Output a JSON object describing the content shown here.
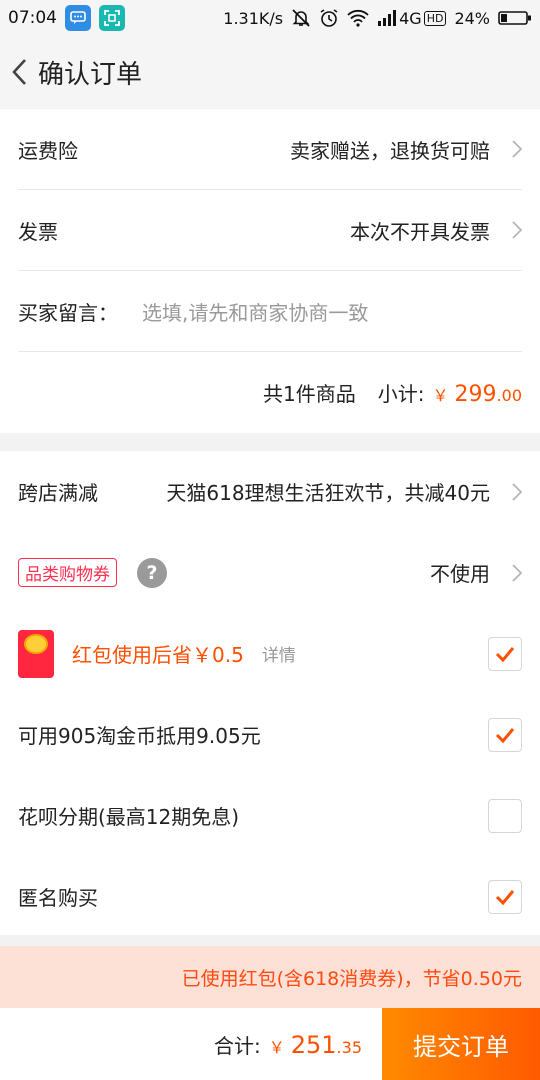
{
  "status_bar": {
    "time": "07:04",
    "speed": "1.31K/s",
    "network": "4G",
    "hd": "HD",
    "battery": "24%",
    "icons": [
      "chat-app-icon",
      "scan-app-icon",
      "mute-bell-icon",
      "alarm-icon",
      "wifi-icon",
      "signal-icon",
      "battery-icon"
    ]
  },
  "header": {
    "title": "确认订单"
  },
  "section1": {
    "shipping_insurance": {
      "label": "运费险",
      "value": "卖家赠送，退换货可赔"
    },
    "invoice": {
      "label": "发票",
      "value": "本次不开具发票"
    },
    "buyer_message": {
      "label": "买家留言：",
      "placeholder": "选填,请先和商家协商一致"
    },
    "subtotal": {
      "count": "共1件商品",
      "label": "小计:",
      "currency": "￥",
      "integer": "299",
      "decimal": ".00"
    }
  },
  "section2": {
    "cross_store": {
      "label": "跨店满减",
      "value": "天猫618理想生活狂欢节，共减40元"
    },
    "category_coupon": {
      "tag": "品类购物券",
      "help": "?",
      "value": "不使用"
    },
    "red_packet": {
      "text": "红包使用后省￥0.5",
      "detail": "详情",
      "checked": true
    },
    "taojinbi": {
      "text": "可用905淘金币抵用9.05元",
      "checked": true
    },
    "huabei": {
      "text": "花呗分期(最高12期免息)",
      "checked": false
    },
    "anonymous": {
      "text": "匿名购买",
      "checked": true
    }
  },
  "notice": {
    "text": "已使用红包(含618消费券)，节省0.50元"
  },
  "bottom_bar": {
    "total_label": "合计:",
    "currency": "￥",
    "integer": "251",
    "decimal": ".35",
    "submit_label": "提交订单"
  },
  "colors": {
    "accent": "#ff5000",
    "coupon": "#ff3050",
    "notice_bg": "#fde0d6"
  }
}
